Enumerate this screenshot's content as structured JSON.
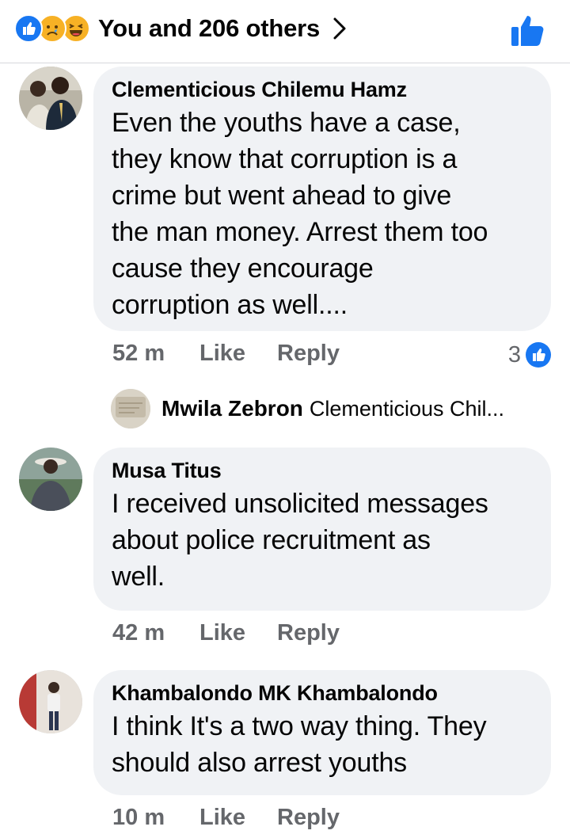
{
  "header": {
    "summary_text": "You and 206 others",
    "reactions": [
      "like-icon",
      "sad-icon",
      "haha-icon"
    ],
    "accent": "#1877f2"
  },
  "comments": [
    {
      "author": "Clementicious Chilemu Hamz",
      "text": "Even the youths have a case,\nthey know that corruption is a\ncrime but went ahead to give\nthe man money. Arrest them too\ncause they encourage\ncorruption as well....",
      "time": "52 m",
      "like_label": "Like",
      "reply_label": "Reply",
      "reaction_count": "3",
      "reply_preview": {
        "name": "Mwila Zebron",
        "snippet": "Clementicious Chil..."
      }
    },
    {
      "author": "Musa Titus",
      "text": "I received unsolicited messages\nabout police recruitment as\nwell.",
      "time": "42 m",
      "like_label": "Like",
      "reply_label": "Reply"
    },
    {
      "author": "Khambalondo MK Khambalondo",
      "text": "I think It's a two way thing. They\nshould also arrest youths",
      "time": "10 m",
      "like_label": "Like",
      "reply_label": "Reply"
    }
  ]
}
